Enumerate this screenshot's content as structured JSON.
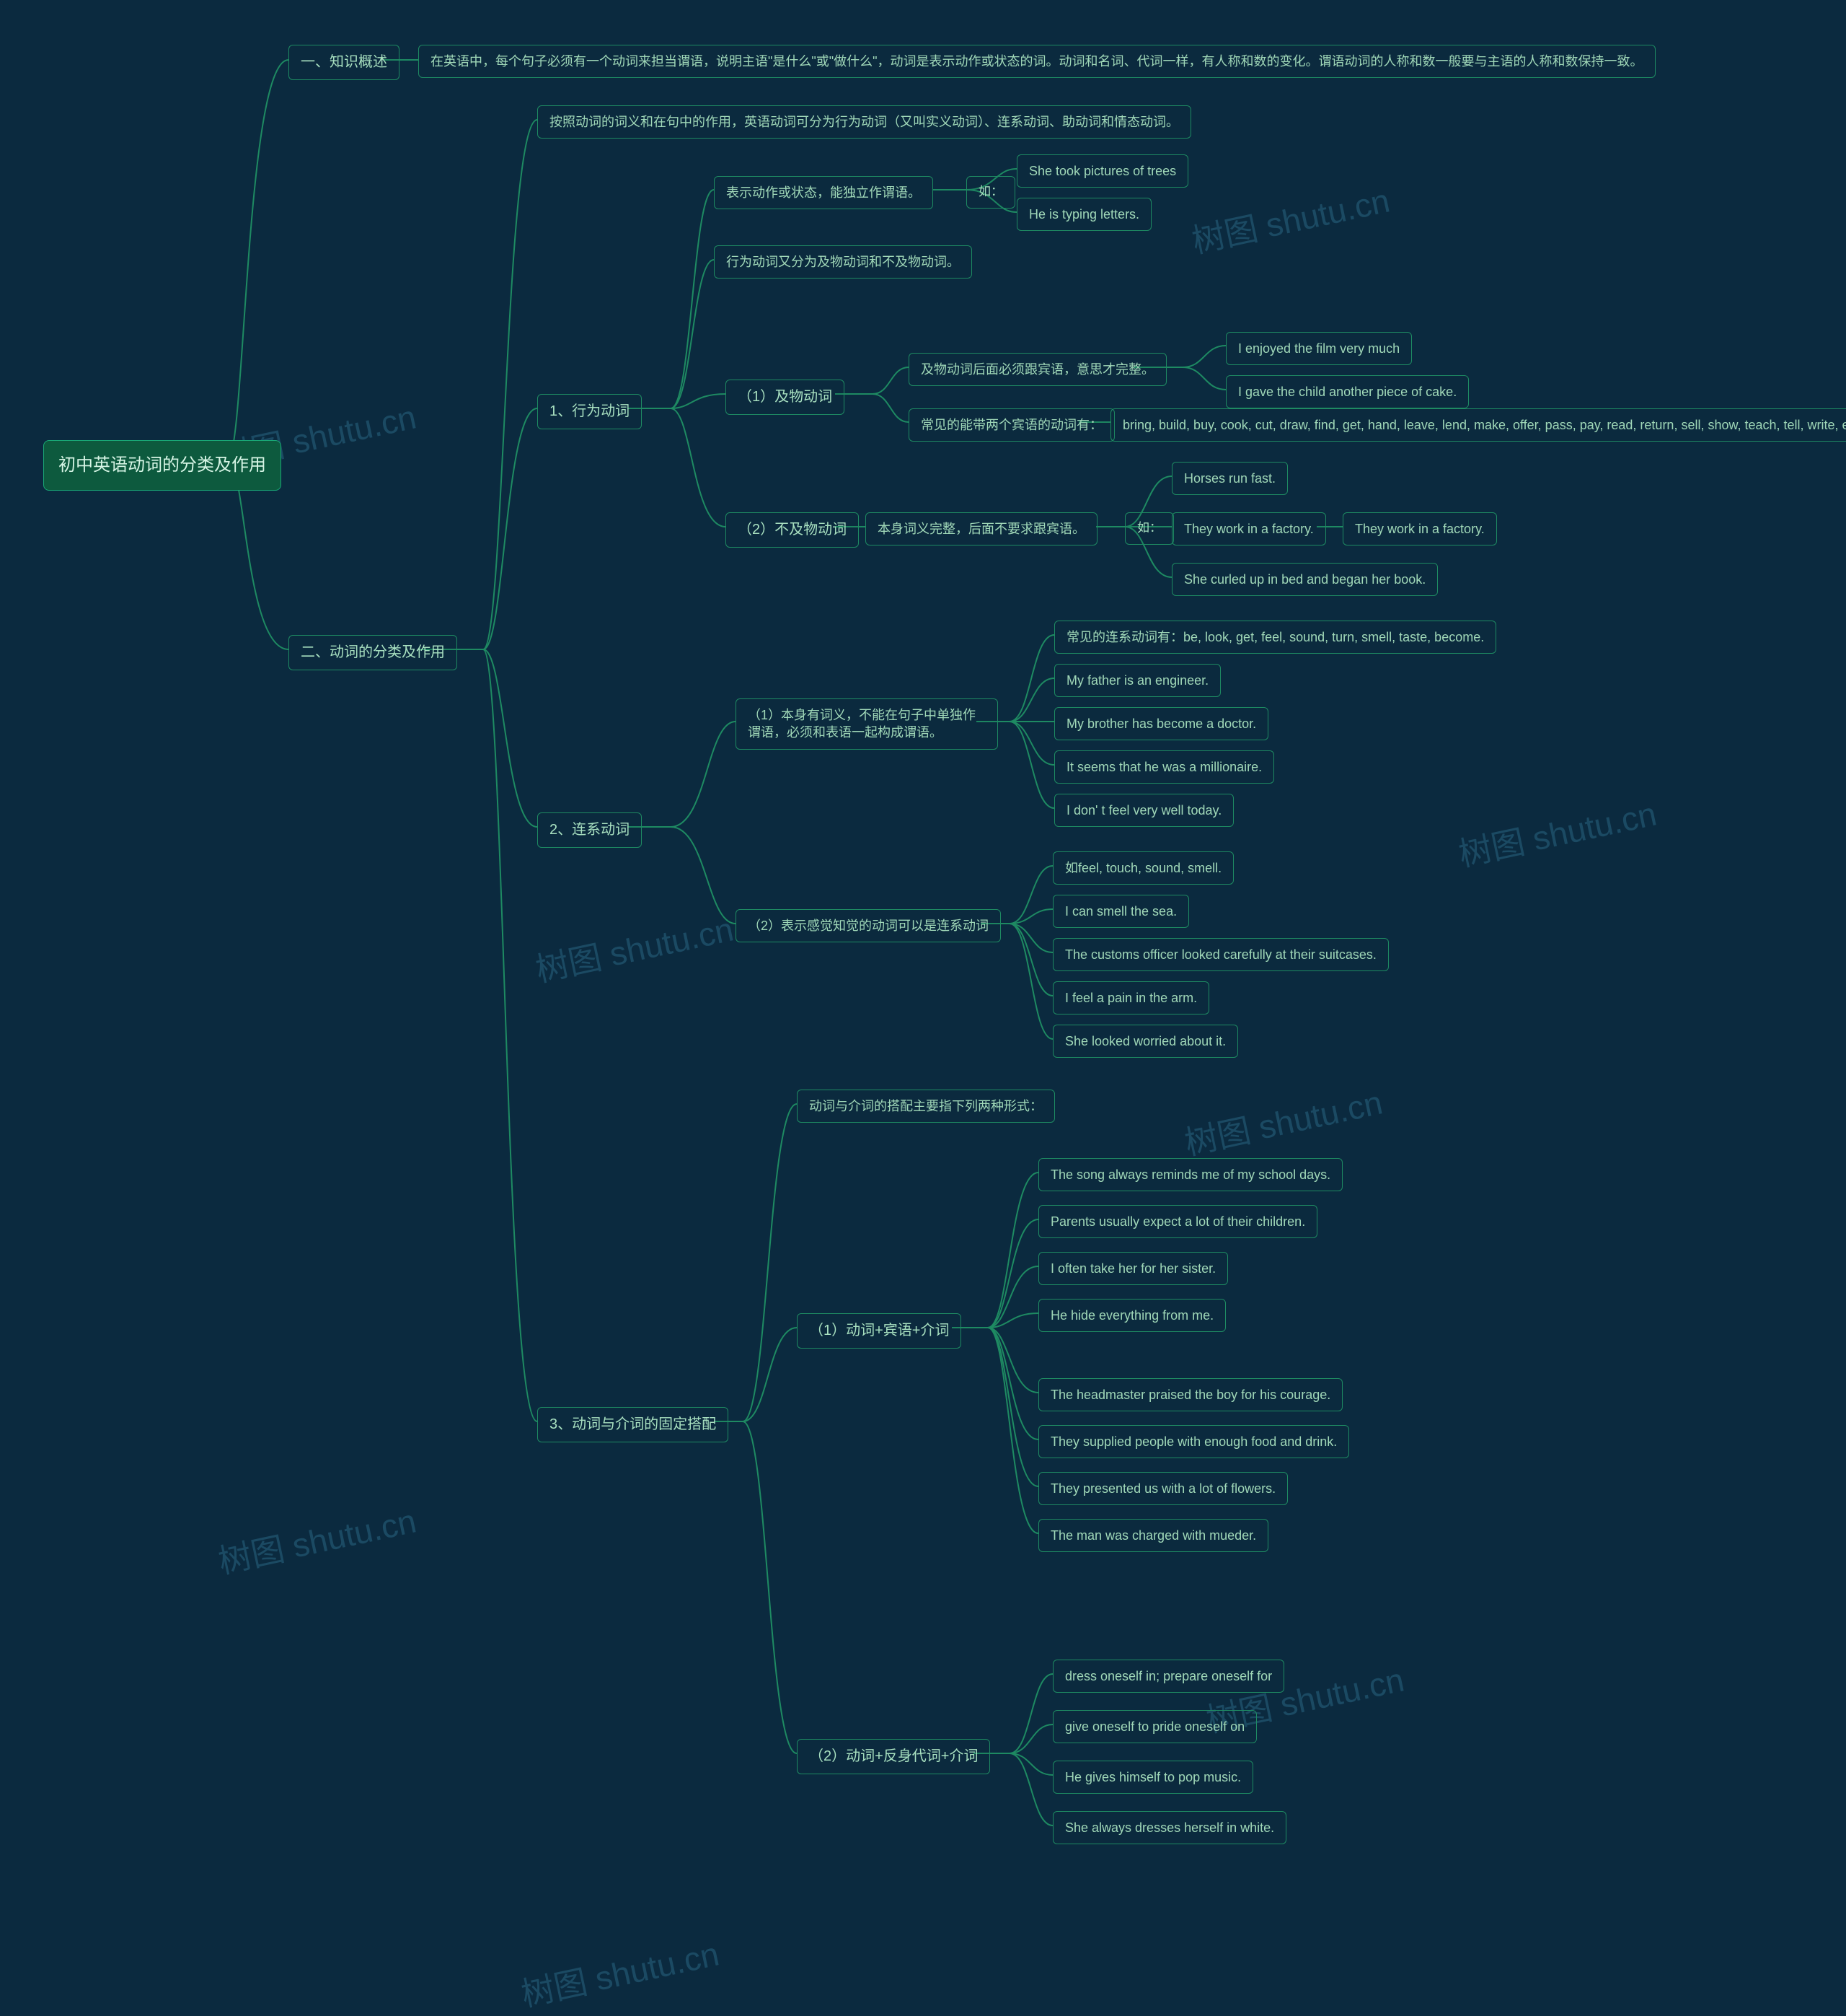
{
  "root": "初中英语动词的分类及作用",
  "section1_title": "一、知识概述",
  "section1_text": "在英语中，每个句子必须有一个动词来担当谓语，说明主语\"是什么\"或\"做什么\"，动词是表示动作或状态的词。动词和名词、代词一样，有人称和数的变化。谓语动词的人称和数一般要与主语的人称和数保持一致。",
  "section2_title": "二、动词的分类及作用",
  "s2_intro": "按照动词的词义和在句中的作用，英语动词可分为行为动词（又叫实义动词）、连系动词、助动词和情态动词。",
  "g1_title": "1、行为动词",
  "g1_a": "表示动作或状态，能独立作谓语。",
  "g1_a_link": "如：",
  "g1_a_ex1": "She took pictures of trees",
  "g1_a_ex2": "He is typing letters.",
  "g1_b": "行为动词又分为及物动词和不及物动词。",
  "g1_1_title": "（1）及物动词",
  "g1_1_a": "及物动词后面必须跟宾语，意思才完整。",
  "g1_1_a_ex1": "I enjoyed the film very much",
  "g1_1_a_ex2": "I gave the child another piece of cake.",
  "g1_1_b": "常见的能带两个宾语的动词有：",
  "g1_1_b_list": "bring, build, buy, cook, cut, draw, find, get, hand, leave, lend, make, offer, pass, pay, read, return, sell, show, teach, tell, write, etc.",
  "g1_2_title": "（2）不及物动词",
  "g1_2_a": "本身词义完整，后面不要求跟宾语。",
  "g1_2_link": "如：",
  "g1_2_ex1": "Horses run fast.",
  "g1_2_ex2": "They work in a factory.",
  "g1_2_ex2b": "They work in a factory.",
  "g1_2_ex3": "She curled up in bed and began her book.",
  "g2_title": "2、连系动词",
  "g2_1_title": "（1）本身有词义，不能在句子中单独作谓语，必须和表语一起构成谓语。",
  "g2_1_l1": "常见的连系动词有：be, look, get, feel, sound, turn, smell, taste, become.",
  "g2_1_l2": "My father is an engineer.",
  "g2_1_l3": "My brother has become a doctor.",
  "g2_1_l4": "It seems that he was a millionaire.",
  "g2_1_l5": "I don' t feel very well today.",
  "g2_2_title": "（2）表示感觉知觉的动词可以是连系动词",
  "g2_2_l1": "如feel, touch, sound, smell.",
  "g2_2_l2": "I can smell the sea.",
  "g2_2_l3": "The customs officer looked carefully at their suitcases.",
  "g2_2_l4": "I feel a pain in the arm.",
  "g2_2_l5": "She looked worried about it.",
  "g3_title": "3、动词与介词的固定搭配",
  "g3_intro": "动词与介词的搭配主要指下列两种形式：",
  "g3_1_title": "（1）动词+宾语+介词",
  "g3_1_l": [
    "The song always reminds me of my school days.",
    "Parents usually expect a lot of their children.",
    "I often take her for her sister.",
    "He hide everything from me.",
    "The headmaster praised the boy for his courage.",
    "They supplied people with enough food and drink.",
    "They presented us with a lot of flowers.",
    "The man was charged with mueder."
  ],
  "g3_2_title": "（2）动词+反身代词+介词",
  "g3_2_l": [
    "dress oneself in;      prepare oneself for",
    "give oneself to     pride oneself on",
    "He gives himself to pop music.",
    "She always dresses herself in white."
  ],
  "wm": "树图 shutu.cn"
}
